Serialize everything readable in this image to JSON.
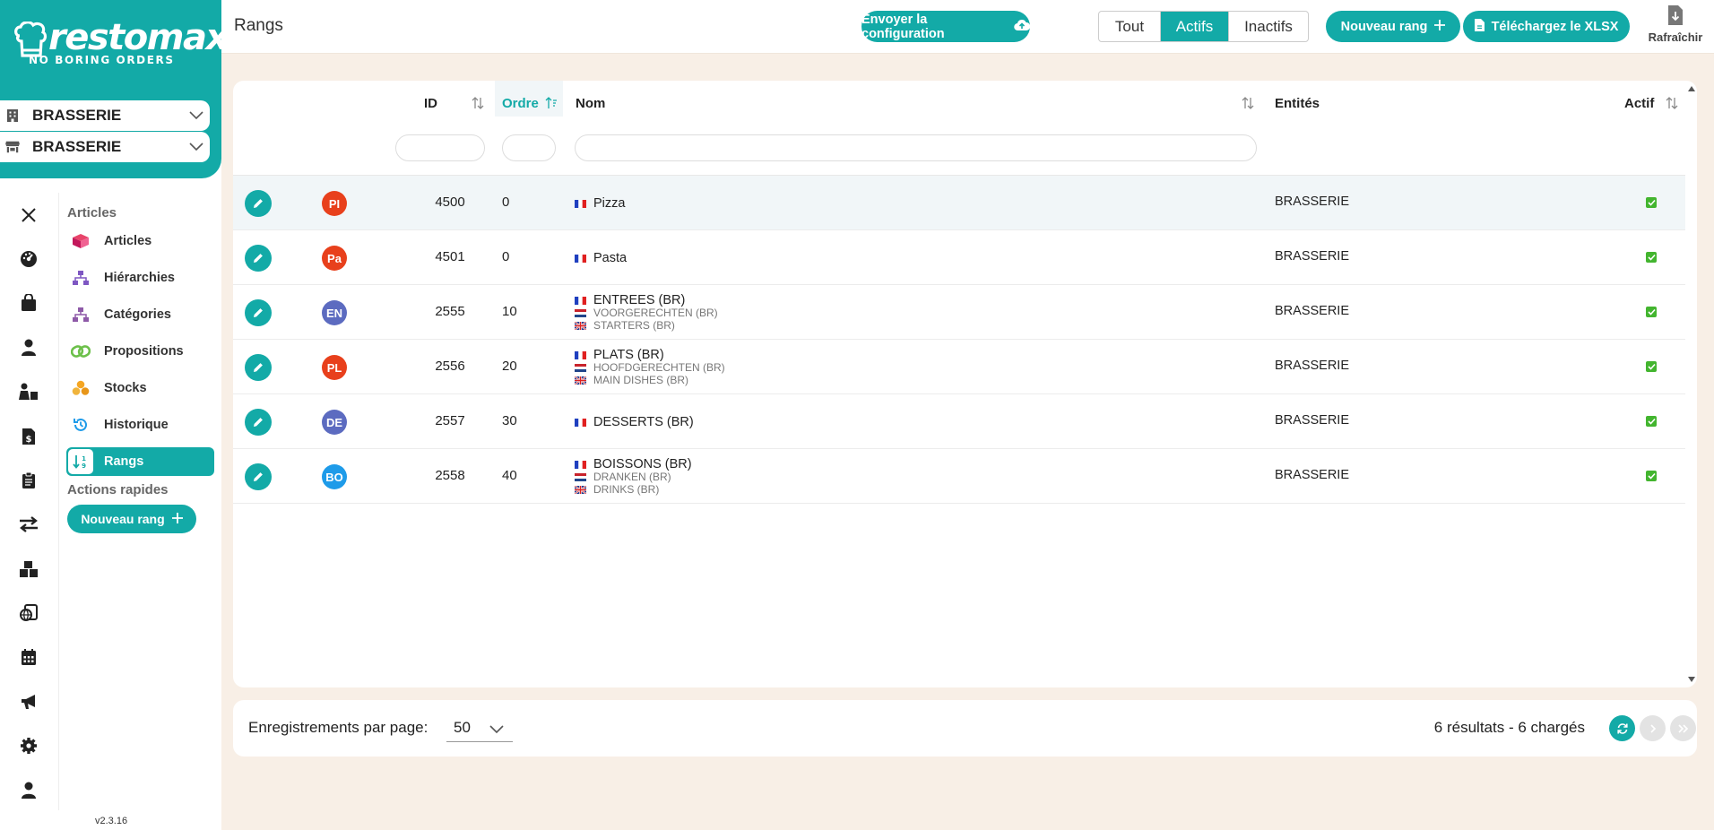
{
  "brand": {
    "name": "restomax",
    "tagline": "NO BORING ORDERS"
  },
  "selectors": [
    {
      "label": "BRASSERIE",
      "icon": "building-icon"
    },
    {
      "label": "BRASSERIE",
      "icon": "store-icon"
    }
  ],
  "rail": [
    "close-icon",
    "dashboard-icon",
    "shopping-bag-icon",
    "user-icon",
    "staff-icon",
    "invoice-icon",
    "clipboard-icon",
    "transfer-icon",
    "boxes-icon",
    "web-icon",
    "calendar-icon",
    "megaphone-icon",
    "settings-icon",
    "account-icon"
  ],
  "submenu": {
    "section_title": "Articles",
    "items": [
      {
        "label": "Articles",
        "icon": "articles-icon"
      },
      {
        "label": "Hiérarchies",
        "icon": "hierarchy-icon"
      },
      {
        "label": "Catégories",
        "icon": "categories-icon"
      },
      {
        "label": "Propositions",
        "icon": "link-icon"
      },
      {
        "label": "Stocks",
        "icon": "coins-icon"
      },
      {
        "label": "Historique",
        "icon": "history-icon"
      },
      {
        "label": "Rangs",
        "icon": "sort-icon"
      }
    ],
    "quick_title": "Actions rapides",
    "quick_button": "Nouveau rang",
    "version": "v2.3.16"
  },
  "topbar": {
    "title": "Rangs",
    "send_config": "Envoyer la configuration",
    "filters": [
      "Tout",
      "Actifs",
      "Inactifs"
    ],
    "active_filter": "Actifs",
    "new_rank": "Nouveau rang",
    "download": "Téléchargez le XLSX",
    "refresh": "Rafraîchir"
  },
  "table": {
    "columns": {
      "id": "ID",
      "order": "Ordre",
      "name": "Nom",
      "entities": "Entités",
      "active": "Actif"
    },
    "rows": [
      {
        "abbr": "PI",
        "color": "#e8401c",
        "id": "4500",
        "order": "0",
        "names": [
          "Pizza"
        ],
        "entity": "BRASSERIE",
        "active": true
      },
      {
        "abbr": "Pa",
        "color": "#e8401c",
        "id": "4501",
        "order": "0",
        "names": [
          "Pasta"
        ],
        "entity": "BRASSERIE",
        "active": true
      },
      {
        "abbr": "EN",
        "color": "#5c6bc0",
        "id": "2555",
        "order": "10",
        "names": [
          "ENTREES (BR)",
          "VOORGERECHTEN (BR)",
          "STARTERS (BR)"
        ],
        "entity": "BRASSERIE",
        "active": true
      },
      {
        "abbr": "PL",
        "color": "#e8401c",
        "id": "2556",
        "order": "20",
        "names": [
          "PLATS (BR)",
          "HOOFDGERECHTEN (BR)",
          "MAIN DISHES (BR)"
        ],
        "entity": "BRASSERIE",
        "active": true
      },
      {
        "abbr": "DE",
        "color": "#5c6bc0",
        "id": "2557",
        "order": "30",
        "names": [
          "DESSERTS (BR)"
        ],
        "entity": "BRASSERIE",
        "active": true
      },
      {
        "abbr": "BO",
        "color": "#1e9be9",
        "id": "2558",
        "order": "40",
        "names": [
          "BOISSONS (BR)",
          "DRANKEN (BR)",
          "DRINKS (BR)"
        ],
        "entity": "BRASSERIE",
        "active": true
      }
    ]
  },
  "footer": {
    "per_page_label": "Enregistrements par page:",
    "per_page_value": "50",
    "results": "6 résultats - 6 chargés"
  },
  "colors": {
    "accent": "#13aaa7",
    "background": "#f8efe6",
    "active_check": "#43b52f"
  }
}
